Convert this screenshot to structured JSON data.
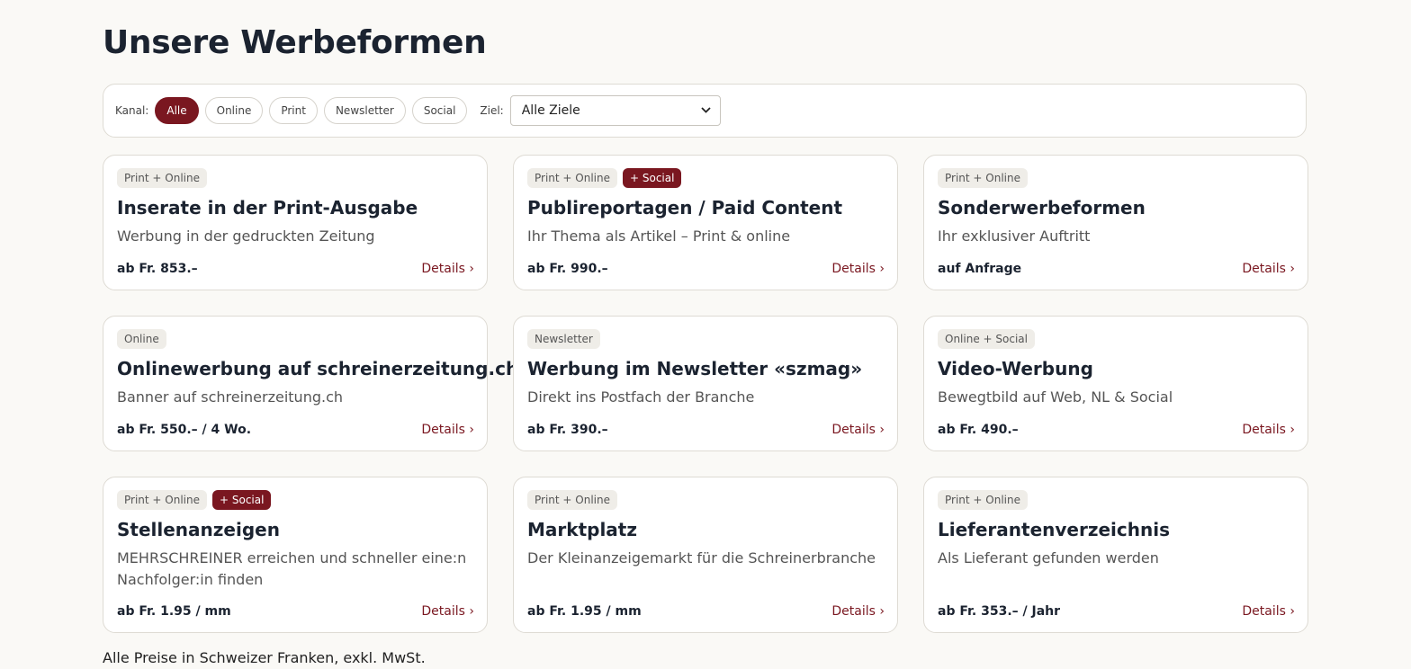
{
  "page_title": "Unsere Werbeformen",
  "filter": {
    "kanal_label": "Kanal:",
    "chips": [
      "Alle",
      "Online",
      "Print",
      "Newsletter",
      "Social"
    ],
    "active_chip": "Alle",
    "ziel_label": "Ziel:",
    "ziel_value": "Alle Ziele"
  },
  "cards": [
    {
      "tags": [
        "Print + Online"
      ],
      "title": "Inserate in der Print-Ausgabe",
      "desc": "Werbung in der gedruckten Zeitung",
      "price": "ab Fr. 853.–",
      "link": "Details ›"
    },
    {
      "tags": [
        "Print + Online",
        "+ Social"
      ],
      "title": "Publireportagen / Paid Content",
      "desc": "Ihr Thema als Artikel – Print & online",
      "price": "ab Fr. 990.–",
      "link": "Details ›"
    },
    {
      "tags": [
        "Print + Online"
      ],
      "title": "Sonderwerbeformen",
      "desc": "Ihr exklusiver Auftritt",
      "price": "auf Anfrage",
      "link": "Details ›"
    },
    {
      "tags": [
        "Online"
      ],
      "title": "Onlinewerbung auf schreinerzeitung.ch",
      "desc": "Banner auf schreinerzeitung.ch",
      "price": "ab Fr. 550.– / 4 Wo.",
      "link": "Details ›"
    },
    {
      "tags": [
        "Newsletter"
      ],
      "title": "Werbung im Newsletter «szmag»",
      "desc": "Direkt ins Postfach der Branche",
      "price": "ab Fr. 390.–",
      "link": "Details ›"
    },
    {
      "tags": [
        "Online + Social"
      ],
      "title": "Video-Werbung",
      "desc": "Bewegtbild auf Web, NL & Social",
      "price": "ab Fr. 490.–",
      "link": "Details ›"
    },
    {
      "tags": [
        "Print + Online",
        "+ Social"
      ],
      "title": "Stellenanzeigen",
      "desc": "MEHRSCHREINER erreichen und schneller eine:n Nachfolger:in finden",
      "price": "ab Fr. 1.95 / mm",
      "link": "Details ›"
    },
    {
      "tags": [
        "Print + Online"
      ],
      "title": "Marktplatz",
      "desc": "Der Kleinanzeigemarkt für die Schreinerbranche",
      "price": "ab Fr. 1.95 / mm",
      "link": "Details ›"
    },
    {
      "tags": [
        "Print + Online"
      ],
      "title": "Lieferantenverzeichnis",
      "desc": "Als Lieferant gefunden werden",
      "price": "ab Fr. 353.– / Jahr",
      "link": "Details ›"
    }
  ],
  "footer_note": "Alle Preise in Schweizer Franken, exkl. MwSt.",
  "colors": {
    "accent": "#7a1720",
    "background": "#faf9f6",
    "tag_bg": "#efede8"
  }
}
